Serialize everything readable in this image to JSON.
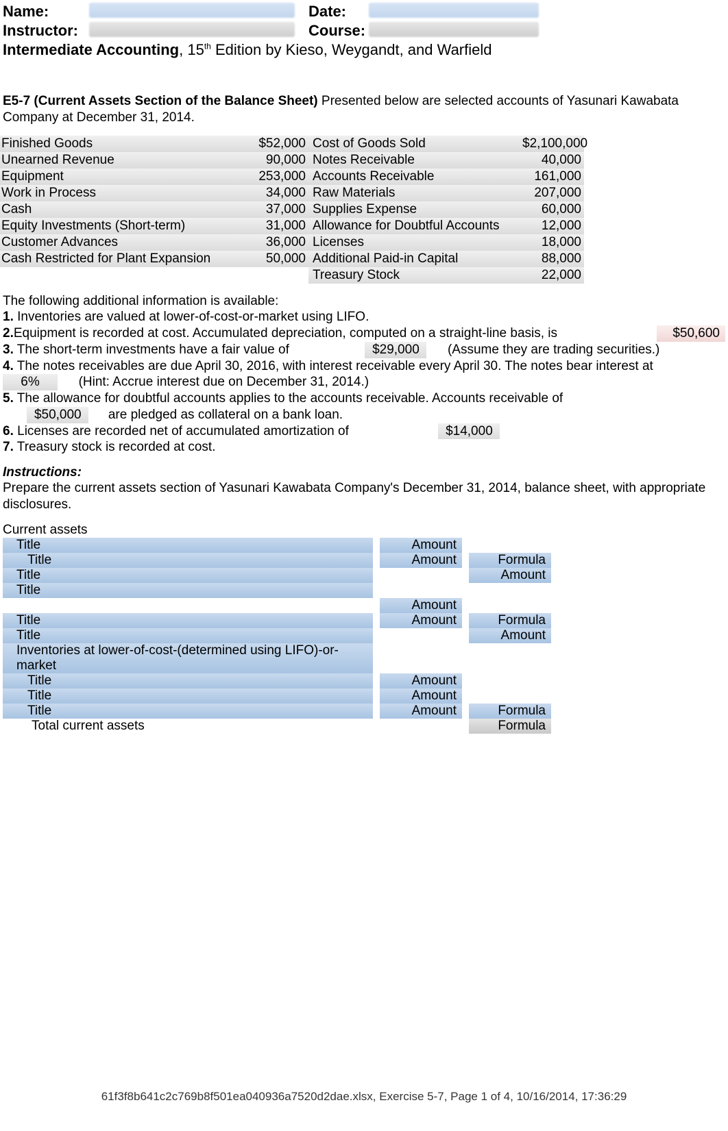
{
  "header": {
    "name_label": "Name:",
    "date_label": "Date:",
    "instructor_label": "Instructor:",
    "course_label": "Course:",
    "book_bold": "Intermediate Accounting",
    "book_rest": ", 15",
    "book_sup": "th",
    "book_tail": " Edition by Kieso, Weygandt, and Warfield"
  },
  "problem": {
    "code": "E5-7 (Current Assets Section of the Balance Sheet)",
    "intro": " Presented below are selected accounts of Yasunari Kawabata Company at December 31, 2014."
  },
  "accounts_left": [
    {
      "name": "Finished Goods",
      "val": "$52,000"
    },
    {
      "name": "Unearned Revenue",
      "val": "90,000"
    },
    {
      "name": "Equipment",
      "val": "253,000"
    },
    {
      "name": "Work in Process",
      "val": "34,000"
    },
    {
      "name": "Cash",
      "val": "37,000"
    },
    {
      "name": "Equity Investments (Short-term)",
      "val": "31,000"
    },
    {
      "name": "Customer Advances",
      "val": "36,000"
    },
    {
      "name": "Cash Restricted for Plant Expansion",
      "val": "50,000"
    }
  ],
  "accounts_right": [
    {
      "name": "Cost of Goods Sold",
      "val": "$2,100,000"
    },
    {
      "name": "Notes Receivable",
      "val": "40,000"
    },
    {
      "name": "Accounts Receivable",
      "val": "161,000"
    },
    {
      "name": "Raw Materials",
      "val": "207,000"
    },
    {
      "name": "Supplies Expense",
      "val": "60,000"
    },
    {
      "name": "Allowance for Doubtful Accounts",
      "val": "12,000"
    },
    {
      "name": "Licenses",
      "val": "18,000"
    },
    {
      "name": "Additional Paid-in Capital",
      "val": "88,000"
    },
    {
      "name": "Treasury Stock",
      "val": "22,000"
    }
  ],
  "addl": {
    "lead": "The following additional information is available:",
    "n1": "1.",
    "t1": " Inventories are valued at lower-of-cost-or-market using LIFO.",
    "n2": "2.",
    "t2": " Equipment is recorded at cost. Accumulated depreciation, computed on a straight-line basis, is",
    "v2": "$50,600",
    "n3": "3.",
    "t3a": " The short-term investments have a fair value of",
    "v3": "$29,000",
    "t3b": "(Assume they are trading securities.)",
    "n4": "4.",
    "t4a": " The notes receivables are due April 30, 2016, with interest receivable every April 30. The notes bear interest at",
    "v4": "6%",
    "t4b": "(Hint: Accrue interest due on December 31, 2014.)",
    "n5": "5.",
    "t5a": " The allowance for doubtful accounts applies to the accounts receivable. Accounts receivable of",
    "v5": "$50,000",
    "t5b": "are pledged as collateral on a bank loan.",
    "n6": "6.",
    "t6": " Licenses are recorded net of accumulated amortization of",
    "v6": "$14,000",
    "n7": "7.",
    "t7": " Treasury stock is recorded at cost."
  },
  "instructions": {
    "head": "Instructions:",
    "body": "Prepare the current assets section of Yasunari Kawabata Company's December 31, 2014, balance sheet, with appropriate disclosures."
  },
  "worksheet": {
    "heading": "Current assets",
    "title": "Title",
    "amount": "Amount",
    "formula": "Formula",
    "inv_line": "Inventories at lower-of-cost-(determined using LIFO)-or-market",
    "total": "Total current assets"
  },
  "footer": "61f3f8b641c2c769b8f501ea040936a7520d2dae.xlsx, Exercise 5-7, Page 1 of 4, 10/16/2014, 17:36:29"
}
